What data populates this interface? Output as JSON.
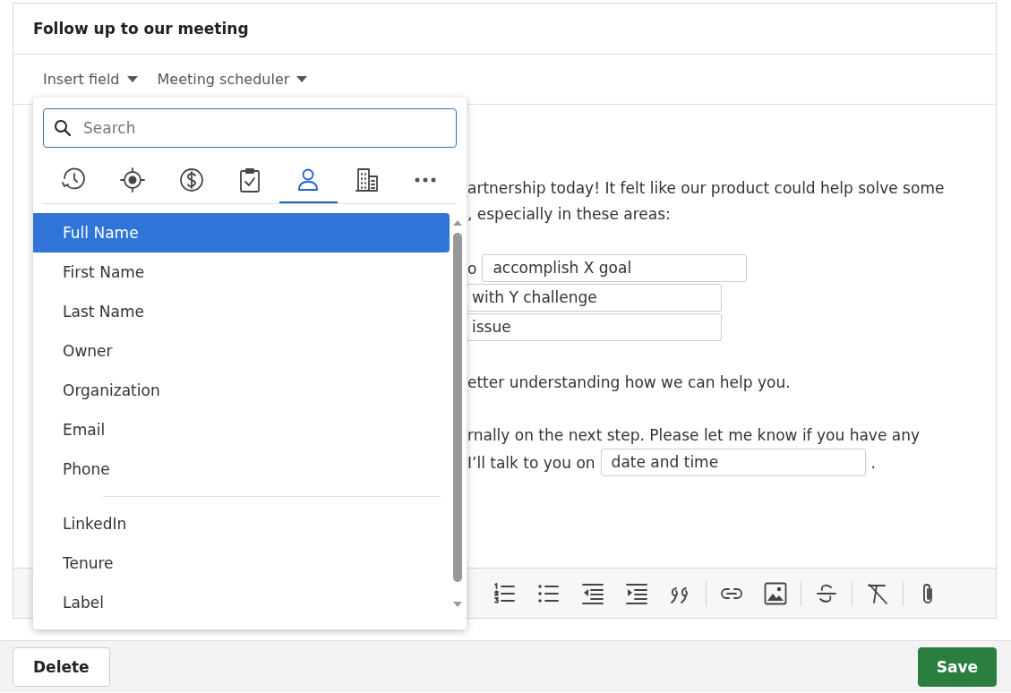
{
  "title": "Follow up to our meeting",
  "toolbar": [
    {
      "label": "Insert field"
    },
    {
      "label": "Meeting scheduler"
    }
  ],
  "paragraphs": [
    {
      "lines": [
        [
          {
            "kind": "text",
            "text": "artnership today! It felt like our product could help solve some"
          }
        ],
        [
          {
            "kind": "text",
            "text": ", especially in these areas:"
          }
        ]
      ]
    },
    {
      "lines": [
        [
          {
            "kind": "text",
            "text": "o"
          },
          {
            "kind": "field",
            "value": "accomplish X goal"
          }
        ],
        [
          {
            "kind": "field",
            "value": "with Y challenge"
          }
        ],
        [
          {
            "kind": "field",
            "value": "issue"
          }
        ]
      ]
    },
    {
      "lines": [
        [
          {
            "kind": "text",
            "text": "etter understanding how we can help you."
          }
        ]
      ]
    },
    {
      "lines": [
        [
          {
            "kind": "text",
            "text": "rnally on the next step. Please let me know if you have any"
          }
        ],
        [
          {
            "kind": "text",
            "text": "I’ll talk to you on"
          },
          {
            "kind": "field",
            "value": "date and time"
          },
          {
            "kind": "text",
            "text": "."
          }
        ]
      ]
    }
  ],
  "format_tools": [
    {
      "kind": "numbered-list"
    },
    {
      "kind": "bullet-list"
    },
    {
      "kind": "outdent"
    },
    {
      "kind": "indent"
    },
    {
      "kind": "quote"
    },
    {
      "kind": "divider"
    },
    {
      "kind": "link"
    },
    {
      "kind": "image"
    },
    {
      "kind": "divider"
    },
    {
      "kind": "strikethrough"
    },
    {
      "kind": "divider"
    },
    {
      "kind": "clear-format"
    },
    {
      "kind": "divider"
    },
    {
      "kind": "attachment"
    }
  ],
  "field_picker": {
    "search": {
      "placeholder": "Search"
    },
    "categories": [
      {
        "kind": "history",
        "selected": false
      },
      {
        "kind": "target",
        "selected": false
      },
      {
        "kind": "money",
        "selected": false
      },
      {
        "kind": "clipboard",
        "selected": false
      },
      {
        "kind": "person",
        "selected": true
      },
      {
        "kind": "building",
        "selected": false
      },
      {
        "kind": "more",
        "selected": false
      }
    ],
    "groups": [
      [
        {
          "label": "Full Name",
          "selected": true
        },
        {
          "label": "First Name",
          "selected": false
        },
        {
          "label": "Last Name",
          "selected": false
        },
        {
          "label": "Owner",
          "selected": false
        },
        {
          "label": "Organization",
          "selected": false
        },
        {
          "label": "Email",
          "selected": false
        },
        {
          "label": "Phone",
          "selected": false
        }
      ],
      [
        {
          "label": "LinkedIn",
          "selected": false
        },
        {
          "label": "Tenure",
          "selected": false
        },
        {
          "label": "Label",
          "selected": false
        }
      ]
    ]
  },
  "buttons": [
    {
      "kind": "secondary",
      "label": "Delete"
    },
    {
      "kind": "primary",
      "label": "Save"
    }
  ]
}
